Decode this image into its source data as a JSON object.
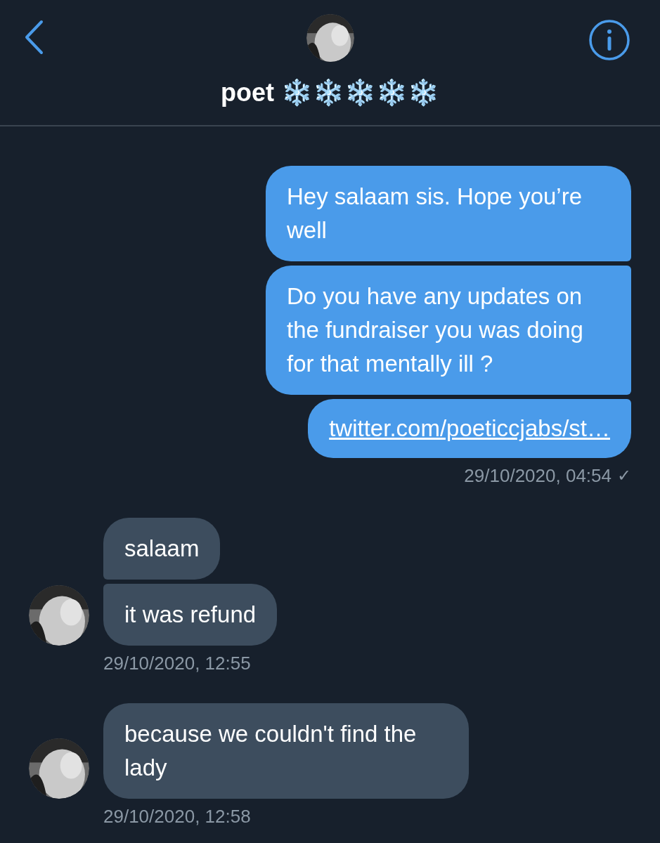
{
  "header": {
    "title": "poet ❄️❄️❄️❄️❄️"
  },
  "groups": [
    {
      "kind": "sent",
      "messages": [
        {
          "kind": "text",
          "text": "Hey salaam sis. Hope you’re well"
        },
        {
          "kind": "text",
          "text": "Do you have any updates on the fundraiser you was doing for that mentally ill ?"
        },
        {
          "kind": "link",
          "text": "twitter.com/poeticcjabs/st…"
        }
      ],
      "timestamp": "29/10/2020, 04:54",
      "status": "✓"
    },
    {
      "kind": "received",
      "messages": [
        {
          "kind": "text",
          "text": "salaam"
        },
        {
          "kind": "text",
          "text": "it was refund"
        }
      ],
      "timestamp": "29/10/2020, 12:55"
    },
    {
      "kind": "received",
      "messages": [
        {
          "kind": "text",
          "text": "because we couldn't find the lady"
        }
      ],
      "timestamp": "29/10/2020, 12:58"
    }
  ]
}
